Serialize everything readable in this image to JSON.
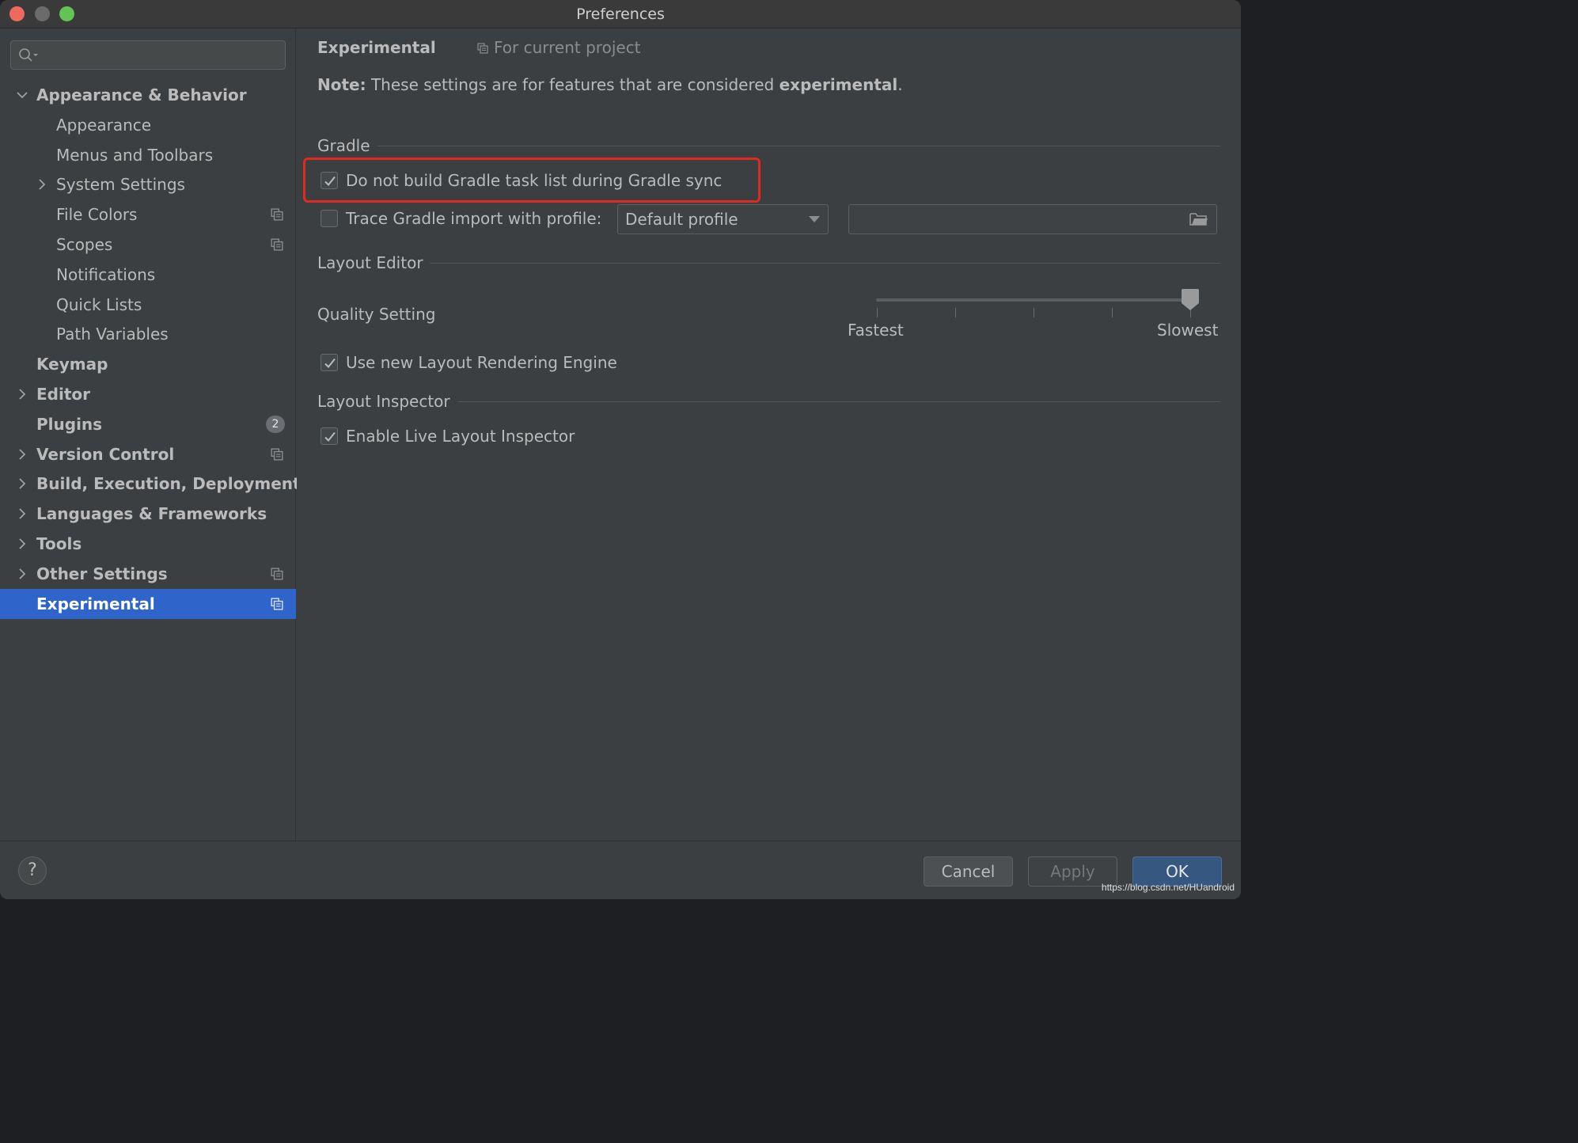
{
  "window": {
    "title": "Preferences"
  },
  "sidebar": {
    "search": {
      "placeholder": "",
      "value": ""
    },
    "items": [
      {
        "label": "Appearance & Behavior",
        "level": 0,
        "expandable": true,
        "expanded": true
      },
      {
        "label": "Appearance",
        "level": 1
      },
      {
        "label": "Menus and Toolbars",
        "level": 1
      },
      {
        "label": "System Settings",
        "level": 1,
        "expandable": true,
        "expanded": false
      },
      {
        "label": "File Colors",
        "level": 1,
        "project_icon": true
      },
      {
        "label": "Scopes",
        "level": 1,
        "project_icon": true
      },
      {
        "label": "Notifications",
        "level": 1
      },
      {
        "label": "Quick Lists",
        "level": 1
      },
      {
        "label": "Path Variables",
        "level": 1
      },
      {
        "label": "Keymap",
        "level": 0
      },
      {
        "label": "Editor",
        "level": 0,
        "expandable": true
      },
      {
        "label": "Plugins",
        "level": 0,
        "badge": "2"
      },
      {
        "label": "Version Control",
        "level": 0,
        "expandable": true,
        "project_icon": true
      },
      {
        "label": "Build, Execution, Deployment",
        "level": 0,
        "expandable": true
      },
      {
        "label": "Languages & Frameworks",
        "level": 0,
        "expandable": true
      },
      {
        "label": "Tools",
        "level": 0,
        "expandable": true
      },
      {
        "label": "Other Settings",
        "level": 0,
        "expandable": true,
        "project_icon": true
      },
      {
        "label": "Experimental",
        "level": 0,
        "selected": true,
        "project_icon": true
      }
    ]
  },
  "main": {
    "title": "Experimental",
    "scope_label": "For current project",
    "note": {
      "prefix": "Note:",
      "text": " These settings are for features that are considered ",
      "emphasis": "experimental",
      "suffix": "."
    },
    "gradle": {
      "heading": "Gradle",
      "no_task_list": {
        "label": "Do not build Gradle task list during Gradle sync",
        "checked": true
      },
      "trace_import": {
        "label": "Trace Gradle import with profile:",
        "checked": false
      },
      "profile_dropdown": {
        "value": "Default profile"
      },
      "profile_path": {
        "value": ""
      }
    },
    "layout_editor": {
      "heading": "Layout Editor",
      "quality_label": "Quality Setting",
      "slider": {
        "min_label": "Fastest",
        "max_label": "Slowest",
        "steps": 5,
        "value_index": 4
      },
      "new_engine": {
        "label": "Use new Layout Rendering Engine",
        "checked": true
      }
    },
    "layout_inspector": {
      "heading": "Layout Inspector",
      "live_inspector": {
        "label": "Enable Live Layout Inspector",
        "checked": true
      }
    }
  },
  "footer": {
    "help_label": "?",
    "cancel_label": "Cancel",
    "apply_label": "Apply",
    "ok_label": "OK",
    "watermark": "https://blog.csdn.net/HUandroid"
  },
  "colors": {
    "background": "#3c3f41",
    "selection": "#2f65ca",
    "highlight_box": "#e2291f",
    "ok_button": "#365880"
  },
  "icons": {
    "search": "search-icon",
    "expand": "chevron-right-icon",
    "collapse": "chevron-down-icon",
    "project_scope": "project-level-icon",
    "checkbox_check": "check-icon",
    "dropdown": "dropdown-arrow-icon",
    "browse": "folder-icon"
  }
}
